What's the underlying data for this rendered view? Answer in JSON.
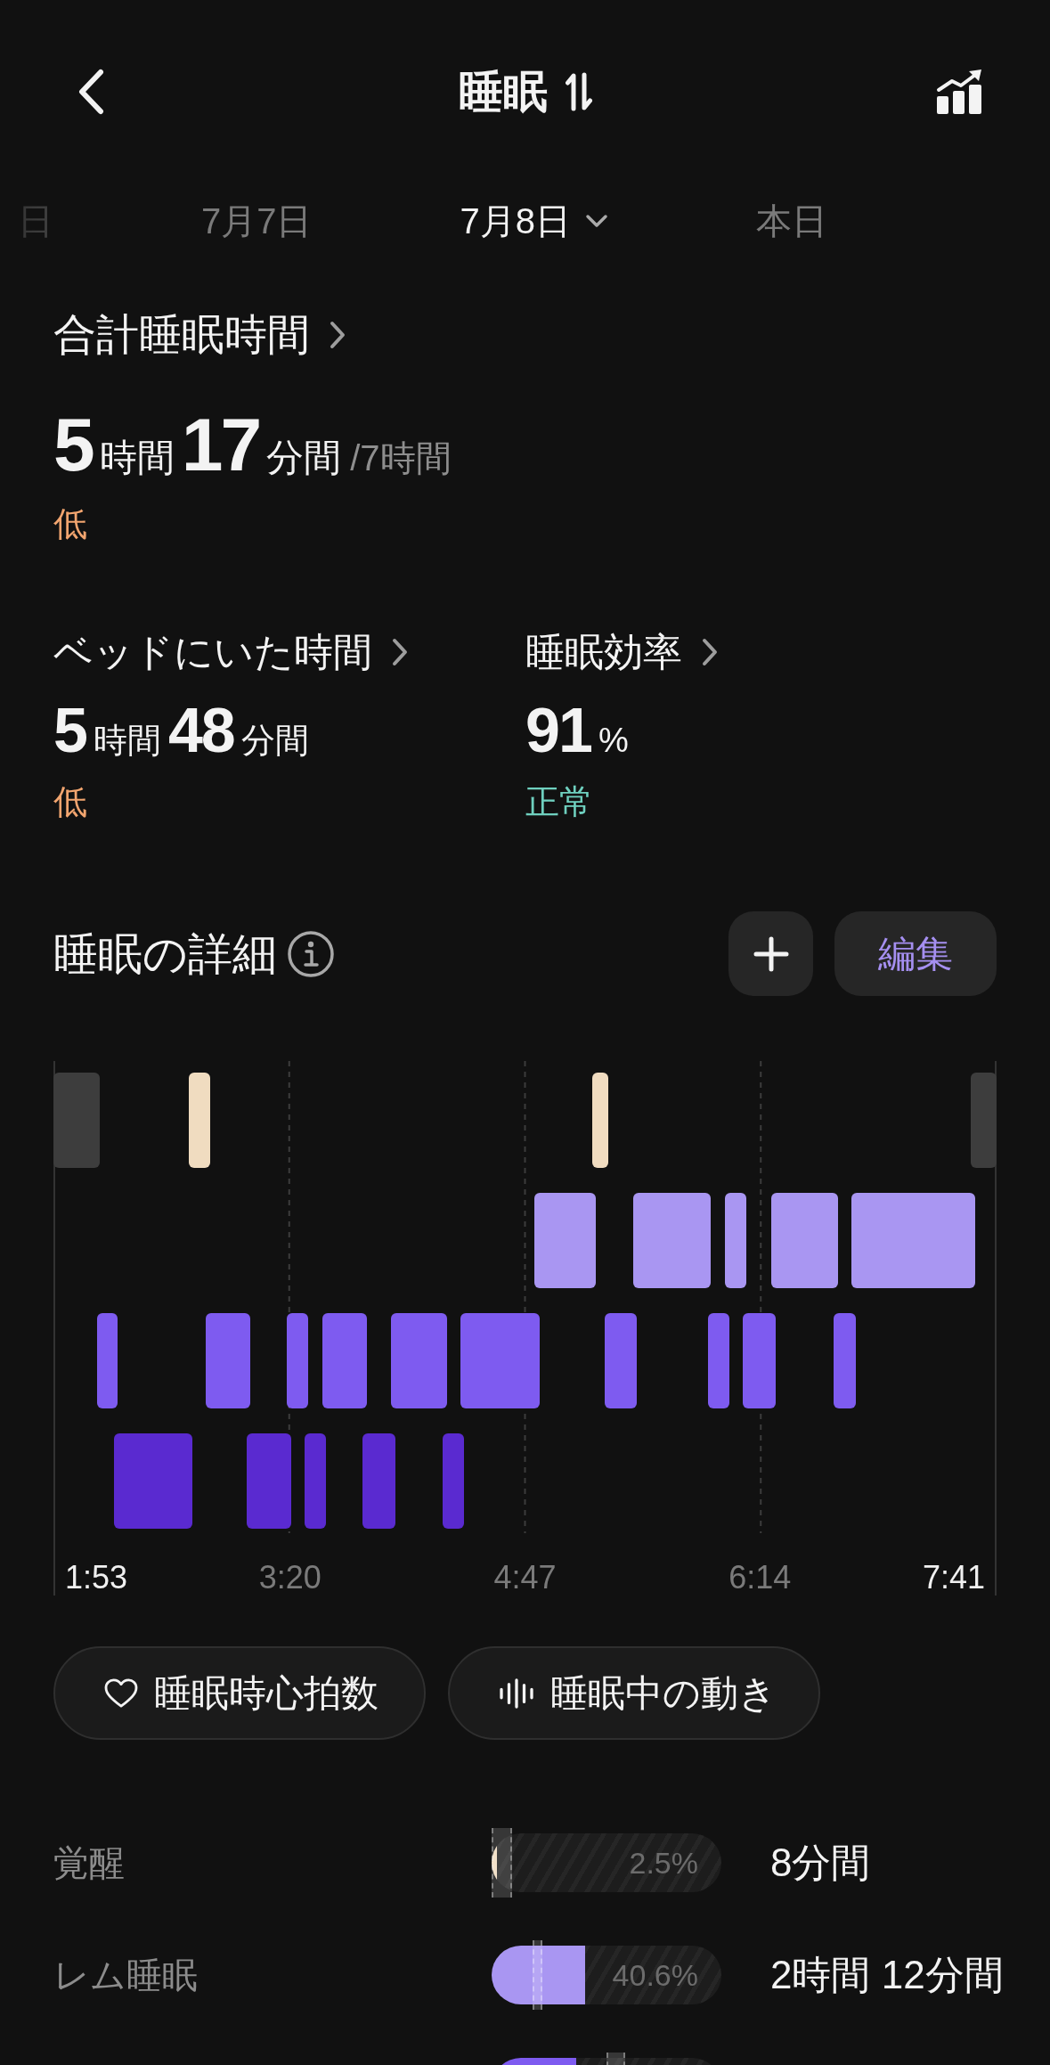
{
  "header": {
    "title": "睡眠"
  },
  "dates": [
    {
      "label": "日",
      "selected": false
    },
    {
      "label": "7月7日",
      "selected": false
    },
    {
      "label": "7月8日",
      "selected": true
    },
    {
      "label": "本日",
      "selected": false
    }
  ],
  "total_sleep": {
    "label": "合計睡眠時間",
    "value": [
      {
        "text": "5",
        "kind": "number"
      },
      {
        "text": "時間",
        "kind": "unit"
      },
      {
        "text": "17",
        "kind": "number"
      },
      {
        "text": "分間",
        "kind": "unit"
      }
    ],
    "goal": "/7時間",
    "status": {
      "text": "低",
      "kind": "low"
    }
  },
  "metrics": [
    {
      "label": "ベッドにいた時間",
      "value": [
        {
          "text": "5",
          "kind": "number"
        },
        {
          "text": "時間",
          "kind": "unit"
        },
        {
          "text": "48",
          "kind": "number"
        },
        {
          "text": "分間",
          "kind": "unit"
        }
      ],
      "status": {
        "text": "低",
        "kind": "low"
      }
    },
    {
      "label": "睡眠効率",
      "value": [
        {
          "text": "91",
          "kind": "number"
        },
        {
          "text": "%",
          "kind": "unit"
        }
      ],
      "status": {
        "text": "正常",
        "kind": "normal"
      }
    }
  ],
  "sleep_detail": {
    "title": "睡眠の詳細",
    "edit_button": "編集",
    "time_labels": [
      {
        "text": "1:53",
        "emphasized": true
      },
      {
        "text": "3:20",
        "emphasized": false
      },
      {
        "text": "4:47",
        "emphasized": false
      },
      {
        "text": "6:14",
        "emphasized": false
      },
      {
        "text": "7:41",
        "emphasized": true
      }
    ]
  },
  "chips": [
    {
      "label": "睡眠時心拍数",
      "kind": "heart"
    },
    {
      "label": "睡眠中の動き",
      "kind": "movement"
    }
  ],
  "stages": [
    {
      "label": "覚醒",
      "color": "#f0dcc0",
      "level": 0.025,
      "percent": "2.5%",
      "duration": "8分間",
      "range": {
        "from": {
          "level": 0
        },
        "to": {
          "level": 0.09
        }
      }
    },
    {
      "label": "レム睡眠",
      "color": "#a996f2",
      "level": 0.406,
      "percent": "40.6%",
      "duration": "2時間 12分間",
      "range": {
        "from": {
          "level": 0.18
        },
        "to": {
          "level": 0.22
        }
      }
    },
    {
      "color": "#7e5bf0",
      "level": 0.37,
      "range": {
        "from": {
          "level": 0.5
        },
        "to": {
          "level": 0.58
        }
      }
    }
  ]
}
